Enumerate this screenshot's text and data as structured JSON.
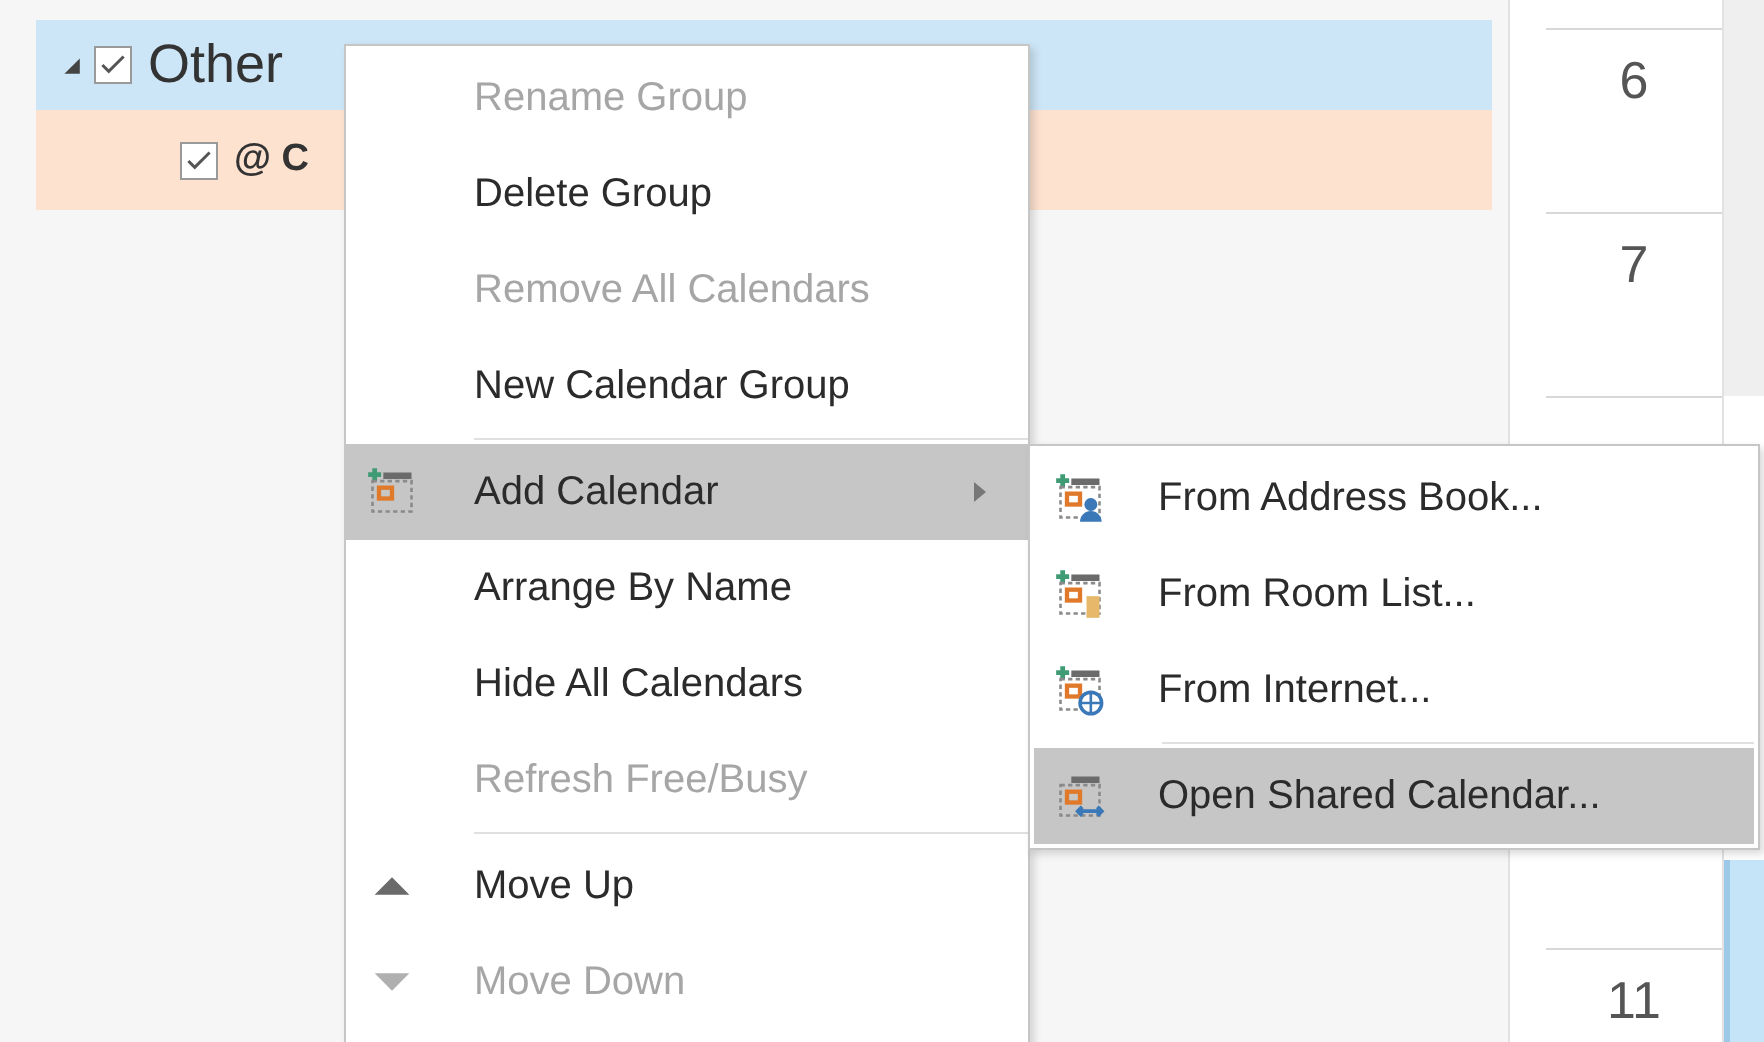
{
  "folder_tree": {
    "label": "Other",
    "checked": true,
    "expanded": true,
    "selected": true,
    "children": [
      {
        "label": "@ C",
        "checked": true,
        "color": "#fde2cf"
      }
    ]
  },
  "time_column": [
    {
      "label": "6"
    },
    {
      "label": "7"
    },
    {
      "label": "11"
    }
  ],
  "context_menu": [
    {
      "kind": "item",
      "label": "Rename Group",
      "disabled": true,
      "selected": false
    },
    {
      "kind": "item",
      "label": "Delete Group",
      "disabled": false,
      "selected": false
    },
    {
      "kind": "item",
      "label": "Remove All Calendars",
      "disabled": true,
      "selected": false
    },
    {
      "kind": "item",
      "label": "New Calendar Group",
      "disabled": false,
      "selected": false
    },
    {
      "kind": "separator"
    },
    {
      "kind": "submenu",
      "label": "Add Calendar",
      "disabled": false,
      "selected": true
    },
    {
      "kind": "item",
      "label": "Arrange By Name",
      "disabled": false,
      "selected": false
    },
    {
      "kind": "item",
      "label": "Hide All Calendars",
      "disabled": false,
      "selected": false
    },
    {
      "kind": "item",
      "label": "Refresh Free/Busy",
      "disabled": true,
      "selected": false
    },
    {
      "kind": "separator"
    },
    {
      "kind": "item",
      "label": "Move Up",
      "disabled": false,
      "selected": false
    },
    {
      "kind": "item",
      "label": "Move Down",
      "disabled": true,
      "selected": false
    }
  ],
  "submenu": [
    {
      "kind": "item",
      "label": "From Address Book...",
      "selected": false
    },
    {
      "kind": "item",
      "label": "From Room List...",
      "selected": false
    },
    {
      "kind": "item",
      "label": "From Internet...",
      "selected": false
    },
    {
      "kind": "separator"
    },
    {
      "kind": "item",
      "label": "Open Shared Calendar...",
      "selected": true
    }
  ]
}
